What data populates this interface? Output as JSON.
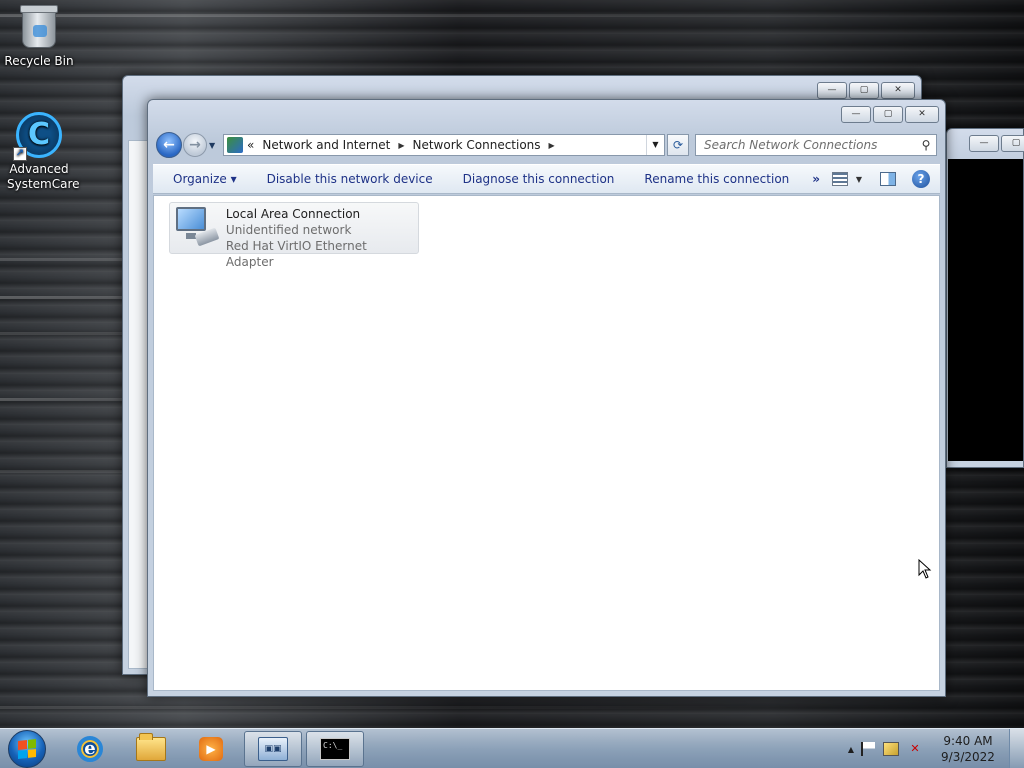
{
  "desktop": {
    "icons": [
      {
        "label": "Recycle Bin"
      },
      {
        "label": "Advanced SystemCare"
      }
    ]
  },
  "window": {
    "controls": {
      "minimize": "—",
      "maximize": "▢",
      "close": "✕"
    },
    "address": {
      "breadcrumb_prefix": "«",
      "crumbs": [
        "Network and Internet",
        "Network Connections"
      ],
      "sep": "▶",
      "dropdown": "▼",
      "refresh": "⟳"
    },
    "search": {
      "placeholder": "Search Network Connections"
    },
    "toolbar": {
      "organize": "Organize ▾",
      "disable": "Disable this network device",
      "diagnose": "Diagnose this connection",
      "rename": "Rename this connection",
      "more": "»",
      "views_drop": "▼",
      "help": "?"
    },
    "connection": {
      "name": "Local Area Connection",
      "network": "Unidentified network",
      "adapter": "Red Hat VirtIO Ethernet Adapter"
    }
  },
  "taskbar": {
    "pinned": [
      "internet-explorer-icon",
      "windows-explorer-icon",
      "windows-media-player-icon",
      "network-control-panel-icon",
      "command-prompt-icon"
    ],
    "cmd_text": "C:\\_",
    "tray_arrow": "▲",
    "clock": {
      "time": "9:40 AM",
      "date": "9/3/2022"
    }
  },
  "colors": {
    "accent": "#1e3287",
    "flag": [
      "#f25022",
      "#7fba00",
      "#00a4ef",
      "#ffb900"
    ]
  }
}
